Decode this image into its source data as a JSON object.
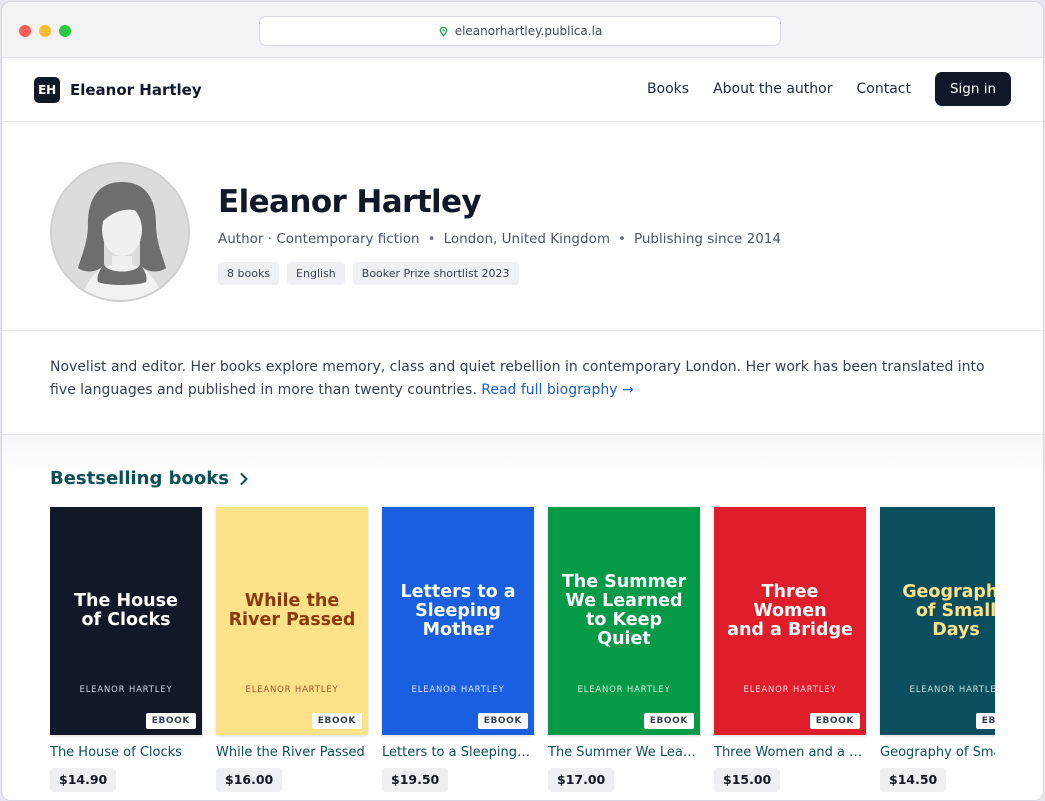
{
  "browser": {
    "url": "eleanorhartley.publica.la"
  },
  "nav": {
    "logo_initials": "EH",
    "site_name": "Eleanor Hartley",
    "links": [
      "Books",
      "About the author",
      "Contact"
    ],
    "signin_label": "Sign in"
  },
  "profile": {
    "name": "Eleanor Hartley",
    "meta": [
      "Author · Contemporary fiction",
      "London, United Kingdom",
      "Publishing since 2014"
    ],
    "tags": [
      "8 books",
      "English",
      "Booker Prize shortlist 2023"
    ]
  },
  "bio": {
    "text": "Novelist and editor. Her books explore memory, class and quiet rebellion in contemporary London. Her work has been translated into five languages and published in more than twenty countries.",
    "read_more": "Read full biography →"
  },
  "books_section": {
    "title": "Bestselling books",
    "books": [
      {
        "cover_title": "The House\nof Clocks",
        "author": "ELEANOR HARTLEY",
        "badge": "EBOOK",
        "title": "The House of Clocks",
        "price": "$14.90",
        "bg": "#111827",
        "fg": "#ffffff",
        "author_fg": "#cbd5e1"
      },
      {
        "cover_title": "While the\nRiver Passed",
        "author": "ELEANOR HARTLEY",
        "badge": "EBOOK",
        "title": "While the River Passed",
        "price": "$16.00",
        "bg": "#fde28a",
        "fg": "#8a3a0b",
        "author_fg": "#a0522d"
      },
      {
        "cover_title": "Letters to a\nSleeping\nMother",
        "author": "ELEANOR HARTLEY",
        "badge": "EBOOK",
        "title": "Letters to a Sleeping Mother",
        "price": "$19.50",
        "bg": "#1a5fe0",
        "fg": "#ffffff",
        "author_fg": "#dbe6fb"
      },
      {
        "cover_title": "The Summer\nWe Learned\nto Keep Quiet",
        "author": "ELEANOR HARTLEY",
        "badge": "EBOOK",
        "title": "The Summer We Learned to Keep Quiet",
        "price": "$17.00",
        "bg": "#059a47",
        "fg": "#ffffff",
        "author_fg": "#d6f1e1"
      },
      {
        "cover_title": "Three Women\nand a Bridge",
        "author": "ELEANOR HARTLEY",
        "badge": "EBOOK",
        "title": "Three Women and a Bridge",
        "price": "$15.00",
        "bg": "#e01e2b",
        "fg": "#ffffff",
        "author_fg": "#fbd9db"
      },
      {
        "cover_title": "Geography\nof Small\nDays",
        "author": "ELEANOR HARTLEY",
        "badge": "EBOOK",
        "title": "Geography of Small Days",
        "price": "$14.50",
        "bg": "#0b4f5e",
        "fg": "#fde28a",
        "author_fg": "#c9e1e5"
      }
    ]
  }
}
